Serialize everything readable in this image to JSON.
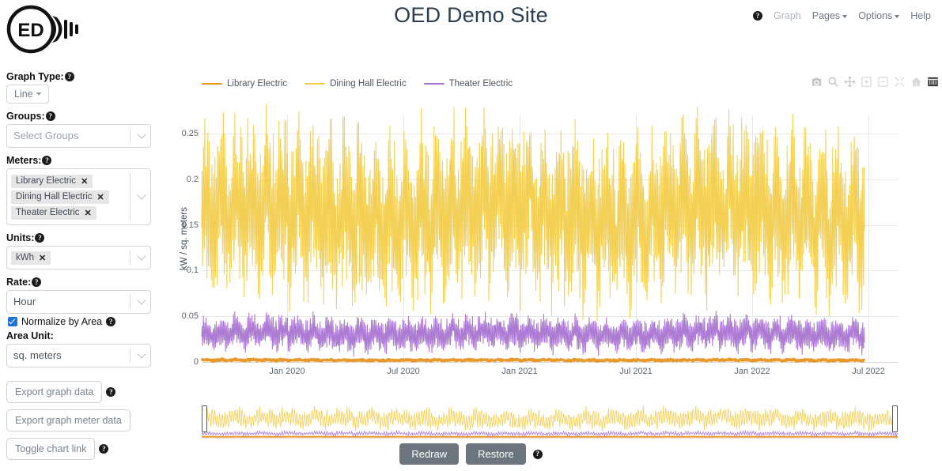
{
  "header": {
    "title": "OED Demo Site",
    "logo_text": "ED",
    "logo_name": "oed-lightbulb-logo"
  },
  "navbar": {
    "help_icon": "help-circle-icon",
    "items": [
      {
        "label": "Graph",
        "has_caret": false,
        "muted": true
      },
      {
        "label": "Pages",
        "has_caret": true,
        "muted": false
      },
      {
        "label": "Options",
        "has_caret": true,
        "muted": false
      },
      {
        "label": "Help",
        "has_caret": false,
        "muted": false
      }
    ]
  },
  "sidebar": {
    "graph_type": {
      "label": "Graph Type:",
      "value": "Line"
    },
    "groups": {
      "label": "Groups:",
      "placeholder": "Select Groups"
    },
    "meters": {
      "label": "Meters:",
      "chips": [
        "Library Electric",
        "Dining Hall Electric",
        "Theater Electric"
      ],
      "remove_glyph": "✕"
    },
    "units": {
      "label": "Units:",
      "chips": [
        "kWh"
      ]
    },
    "rate": {
      "label": "Rate:",
      "value": "Hour"
    },
    "normalize": {
      "label": "Normalize by Area",
      "checked": true
    },
    "area_unit": {
      "label": "Area Unit:",
      "value": "sq. meters"
    },
    "buttons": [
      {
        "label": "Export graph data",
        "has_help": true
      },
      {
        "label": "Export graph meter data",
        "has_help": false
      },
      {
        "label": "Toggle chart link",
        "has_help": true
      }
    ]
  },
  "chart_data": {
    "type": "line",
    "title": "",
    "xlabel": "",
    "ylabel": "kW / sq. meters",
    "ylim": [
      0,
      0.27
    ],
    "yticks": [
      0,
      0.05,
      0.1,
      0.15,
      0.2,
      0.25
    ],
    "ytick_labels": [
      "0",
      "0.05",
      "0.1",
      "0.15",
      "0.2",
      "0.25"
    ],
    "xticks": [
      "Jan 2020",
      "Jul 2020",
      "Jan 2021",
      "Jul 2021",
      "Jan 2022",
      "Jul 2022"
    ],
    "xlim": [
      "Oct 2019",
      "Oct 2022"
    ],
    "grid": true,
    "legend_position": "top-left",
    "series": [
      {
        "name": "Library Electric",
        "color": "#e8921f",
        "mean": 0.002,
        "amplitude": 0.0016
      },
      {
        "name": "Dining Hall Electric",
        "color": "#f2ce4b",
        "mean": 0.163,
        "amplitude": 0.093
      },
      {
        "name": "Theater Electric",
        "color": "#a974d1",
        "mean": 0.031,
        "amplitude": 0.019
      }
    ]
  },
  "modebar": {
    "buttons": [
      "camera-icon",
      "zoom-icon",
      "pan-icon",
      "zoom-in-icon",
      "zoom-out-icon",
      "autoscale-icon",
      "home-icon",
      "grid-icon"
    ],
    "active": "grid-icon"
  },
  "rangeslider": {
    "name": "range-slider"
  },
  "footer": {
    "redraw_label": "Redraw",
    "restore_label": "Restore",
    "has_help": true
  }
}
